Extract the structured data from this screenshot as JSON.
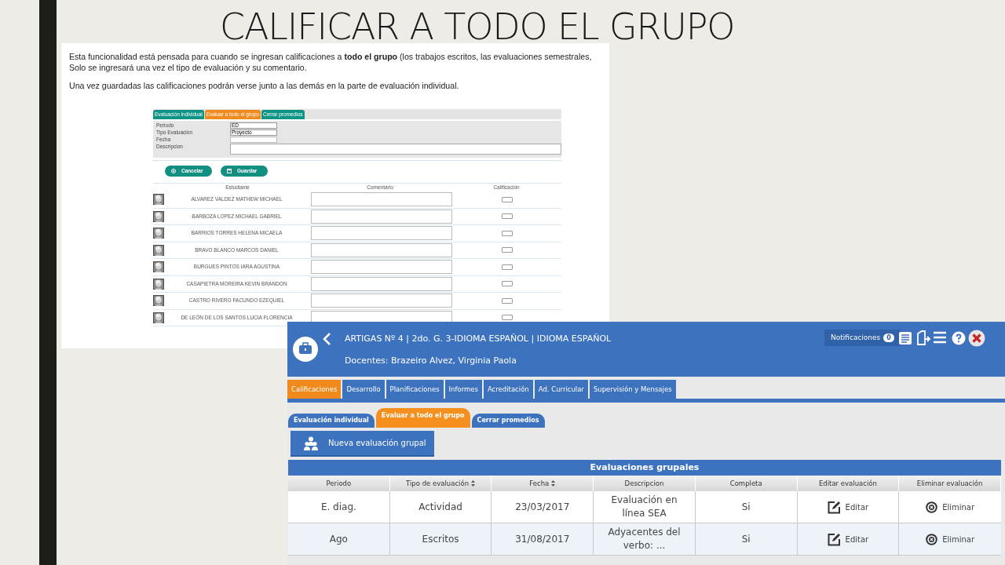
{
  "slide_title": "CALIFICAR A TODO EL GRUPO",
  "description": {
    "paragraphs": [
      [
        "Esta funcionalidad está pensada para cuando se ingresan calificaciones a **todo el grupo** (los trabajos escritos, las evaluaciones semestrales,",
        "Solo se ingresará una vez el tipo de evaluación y su comentario."
      ],
      [
        "Una vez guardadas las calificaciones podrán verse junto a las demás en la parte de evaluación individual."
      ]
    ]
  },
  "old_app": {
    "tabs": [
      {
        "label": "Evaluación individual",
        "selected": false
      },
      {
        "label": "Evaluar a todo el grupo",
        "selected": true
      },
      {
        "label": "Cerrar promedios",
        "selected": false
      }
    ],
    "fields": [
      {
        "label": "Periodo",
        "kind": "select",
        "value": "ED"
      },
      {
        "label": "Tipo Evaluación",
        "kind": "select",
        "value": "Proyecto"
      },
      {
        "label": "Fecha",
        "kind": "text"
      },
      {
        "label": "Descripcion",
        "kind": "textarea"
      }
    ],
    "buttons": [
      "Cancelar",
      "Guardar"
    ],
    "columns": [
      "Estudiante",
      "Comentario",
      "Calificación"
    ],
    "students": [
      {
        "name": "ALVAREZ VALDEZ MATHEW MICHAEL"
      },
      {
        "name": "BARBOZA LOPEZ MICHAEL GABRIEL"
      },
      {
        "name": "BARRIOS TORRES HELENA MICAELA"
      },
      {
        "name": "BRAVO BLANCO MARCOS DANIEL"
      },
      {
        "name": "BURGUES PINTOS IARA AGUSTINA"
      },
      {
        "name": "CASAPIETRA MOREIRA KEVIN BRANDON"
      },
      {
        "name": "CASTRO RIVERO FACUNDO EZEQUIEL"
      },
      {
        "name": "DE LEÓN DE LOS SANTOS LUCIA FLORENCIA"
      }
    ]
  },
  "new_app": {
    "header": {
      "title": "ARTIGAS Nº 4 | 2do. G. 3-IDIOMA ESPAÑOL | IDIOMA ESPAÑOL",
      "teachers": "Docentes: Brazeiro Alvez, Virginia Paola",
      "notifications_label": "Notificaciones",
      "notifications_count": "0"
    },
    "nav_tabs": [
      {
        "label": "Calificaciones",
        "selected": true
      },
      {
        "label": "Desarrollo",
        "selected": false
      },
      {
        "label": "Planificaciones",
        "selected": false
      },
      {
        "label": "Informes",
        "selected": false
      },
      {
        "label": "Acreditación",
        "selected": false
      },
      {
        "label": "Ad. Curricular",
        "selected": false
      },
      {
        "label": "Supervisión y Mensajes",
        "selected": false
      }
    ],
    "sub_tabs": [
      {
        "label": "Evaluación individual",
        "selected": false
      },
      {
        "label": "Evaluar a todo el grupo",
        "selected": true
      },
      {
        "label": "Cerrar promedios",
        "selected": false
      }
    ],
    "new_button": "Nueva evaluación grupal",
    "table": {
      "title": "Evaluaciones grupales",
      "columns": [
        {
          "label": "Periodo",
          "sortable": false
        },
        {
          "label": "Tipo de evaluación",
          "sortable": true
        },
        {
          "label": "Fecha",
          "sortable": true
        },
        {
          "label": "Descripcion",
          "sortable": false
        },
        {
          "label": "Completa",
          "sortable": false
        },
        {
          "label": "Editar evaluación",
          "sortable": false
        },
        {
          "label": "Eliminar evaluación",
          "sortable": false
        }
      ],
      "rows": [
        {
          "periodo": "E. diag.",
          "tipo": "Actividad",
          "fecha": "23/03/2017",
          "descripcion": "Evaluación en línea SEA",
          "completa": "Si",
          "edit": "Editar",
          "delete": "Eliminar"
        },
        {
          "periodo": "Ago",
          "tipo": "Escritos",
          "fecha": "31/08/2017",
          "descripcion": "Adyacentes del verbo: ...",
          "completa": "Si",
          "edit": "Editar",
          "delete": "Eliminar"
        }
      ]
    }
  }
}
